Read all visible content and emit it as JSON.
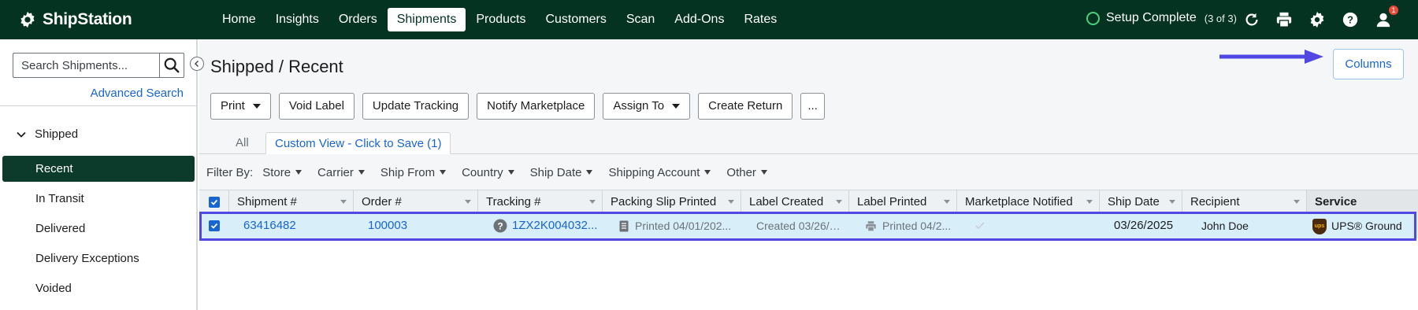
{
  "app": {
    "brand": "ShipStation"
  },
  "nav": {
    "items": [
      "Home",
      "Insights",
      "Orders",
      "Shipments",
      "Products",
      "Customers",
      "Scan",
      "Add-Ons",
      "Rates"
    ],
    "active": "Shipments"
  },
  "status": {
    "setup_label": "Setup Complete",
    "setup_count": "(3 of 3)",
    "notification_count": "1"
  },
  "icons": [
    "refresh-icon",
    "printer-icon",
    "gear-icon",
    "help-icon",
    "user-icon",
    "search-icon",
    "chevron-down-icon",
    "chevron-left-icon",
    "arrow-right-icon",
    "help-circle-icon",
    "document-icon",
    "checkmark-icon",
    "ups-logo-icon"
  ],
  "colors": {
    "nav_bg": "#053322",
    "active_sidebar": "#0d3b2b",
    "link": "#1765d0",
    "highlight": "#5147e3",
    "row_selected": "#d8eef9"
  },
  "sidebar": {
    "search_placeholder": "Search Shipments...",
    "advanced_search": "Advanced Search",
    "group": "Shipped",
    "items": [
      "Recent",
      "In Transit",
      "Delivered",
      "Delivery Exceptions",
      "Voided"
    ],
    "active": "Recent"
  },
  "main": {
    "title": "Shipped / Recent",
    "columns_button": "Columns",
    "toolbar": {
      "print": "Print",
      "void_label": "Void Label",
      "update_tracking": "Update Tracking",
      "notify_marketplace": "Notify Marketplace",
      "assign_to": "Assign To",
      "create_return": "Create Return",
      "more": "..."
    },
    "tabs": {
      "all": "All",
      "custom": "Custom View - Click to Save (1)"
    },
    "filters": {
      "label": "Filter By:",
      "items": [
        "Store",
        "Carrier",
        "Ship From",
        "Country",
        "Ship Date",
        "Shipping Account",
        "Other"
      ]
    },
    "grid": {
      "headers": [
        "Shipment #",
        "Order #",
        "Tracking #",
        "Packing Slip Printed",
        "Label Created",
        "Label Printed",
        "Marketplace Notified",
        "Ship Date",
        "Recipient",
        "Service"
      ],
      "rows": [
        {
          "selected": true,
          "shipment": "63416482",
          "order": "100003",
          "tracking": "1ZX2K004032...",
          "packing_slip": "Printed 04/01/202...",
          "label_created": "Created 03/26/2...",
          "label_printed": "Printed 04/2...",
          "marketplace_notified": "",
          "ship_date": "03/26/2025",
          "recipient": "John Doe",
          "service": "UPS® Ground"
        }
      ]
    }
  }
}
